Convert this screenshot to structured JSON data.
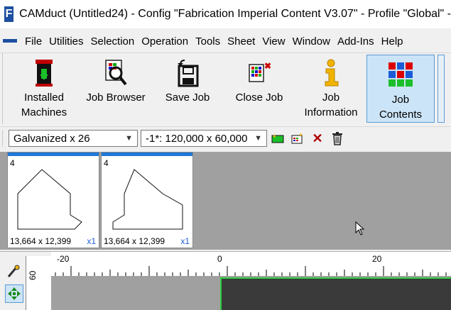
{
  "window": {
    "title": "CAMduct (Untitled24) - Config \"Fabrication Imperial Content V3.07\" - Profile \"Global\" -",
    "app_icon": "F"
  },
  "menu": [
    "File",
    "Utilities",
    "Selection",
    "Operation",
    "Tools",
    "Sheet",
    "View",
    "Window",
    "Add-Ins",
    "Help"
  ],
  "toolbar": {
    "buttons": [
      {
        "line1": "Installed",
        "line2": "Machines",
        "icon": "machine-icon"
      },
      {
        "line1": "Job Browser",
        "line2": "",
        "icon": "magnifier-icon"
      },
      {
        "line1": "Save Job",
        "line2": "",
        "icon": "floppy-icon"
      },
      {
        "line1": "Close Job",
        "line2": "",
        "icon": "close-job-icon"
      },
      {
        "line1": "Job",
        "line2": "Information",
        "icon": "info-icon"
      },
      {
        "line1": "Job",
        "line2": "Contents",
        "icon": "grid-icon"
      }
    ]
  },
  "sheet_toolbar": {
    "material": "Galvanized x 26",
    "sheet_size": "-1*: 120,000 x 60,000"
  },
  "parts": [
    {
      "num": "4",
      "dims": "13,664 x 12,399",
      "qty": "x1"
    },
    {
      "num": "4",
      "dims": "13,664 x 12,399",
      "qty": "x1"
    }
  ],
  "ruler": {
    "h_labels": [
      "-20",
      "0",
      "20"
    ],
    "v_label": "60"
  },
  "colors": {
    "accent": "#1e78d7",
    "selected_bg": "#cce4f7",
    "sheet_border": "#2ecc40"
  }
}
